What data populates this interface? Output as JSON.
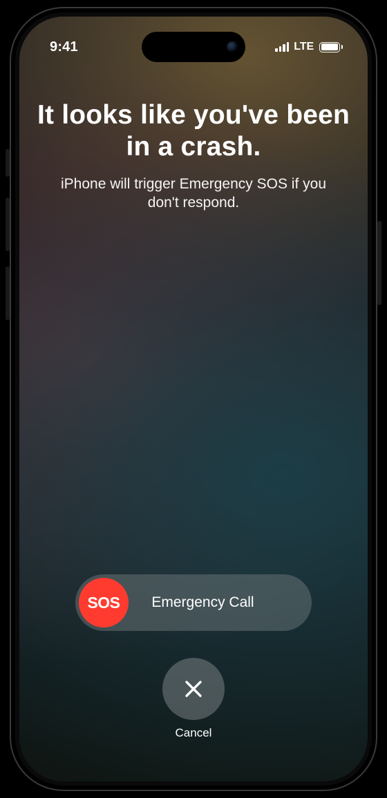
{
  "status_bar": {
    "time": "9:41",
    "network_label": "LTE"
  },
  "main": {
    "title": "It looks like you've been in a crash.",
    "subtitle": "iPhone will trigger Emergency SOS if you don't respond."
  },
  "slider": {
    "knob_label": "SOS",
    "track_label": "Emergency Call"
  },
  "cancel": {
    "label": "Cancel"
  },
  "colors": {
    "sos_red": "#ff3b30"
  }
}
